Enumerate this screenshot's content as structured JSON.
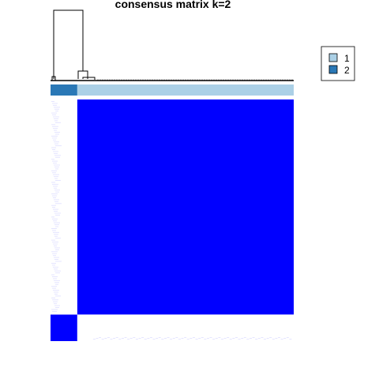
{
  "chart_data": {
    "type": "heatmap",
    "title": "consensus matrix k=2",
    "cluster_order": [
      "2",
      "1"
    ],
    "cluster_fractions": [
      0.11,
      0.89
    ],
    "matrix": [
      [
        1,
        0
      ],
      [
        0,
        1
      ]
    ],
    "colors": {
      "high": "#0000FF",
      "low": "#FFFFFF",
      "low_noise": "#E4E4FF",
      "dendrogram": "#000000",
      "legend_border": "#000000"
    },
    "legend": {
      "position": "top-right",
      "entries": [
        {
          "label": "1",
          "color": "#ABD0E6"
        },
        {
          "label": "2",
          "color": "#2A78B6"
        }
      ]
    }
  }
}
